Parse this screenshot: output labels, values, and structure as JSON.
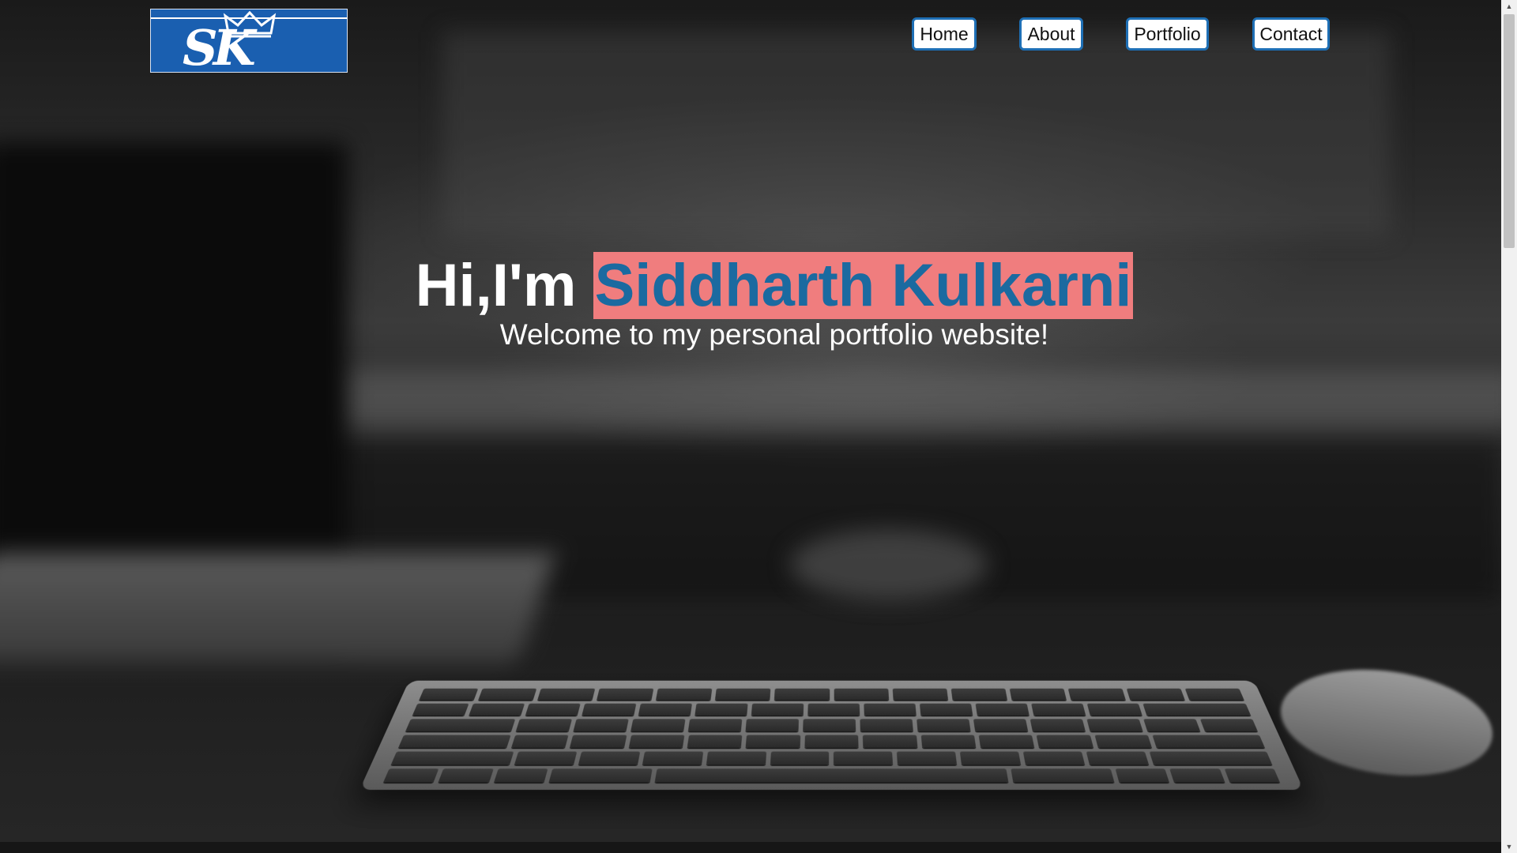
{
  "header": {
    "logo_alt": "SK",
    "nav": [
      {
        "label": "Home"
      },
      {
        "label": "About"
      },
      {
        "label": "Portfolio"
      },
      {
        "label": "Contact"
      }
    ]
  },
  "hero": {
    "greeting": "Hi,I'm ",
    "name": "Siddharth Kulkarni",
    "subtitle": "Welcome to my personal portfolio website!"
  },
  "colors": {
    "nav_border": "#1e6fb5",
    "name_highlight": "#f07d7e",
    "name_text": "#1b6aa0",
    "logo_bg": "#1a5fb0"
  },
  "icons": {
    "logo": "crown-sk-logo",
    "scroll_up": "triangle-up-icon",
    "scroll_down": "triangle-down-icon"
  }
}
